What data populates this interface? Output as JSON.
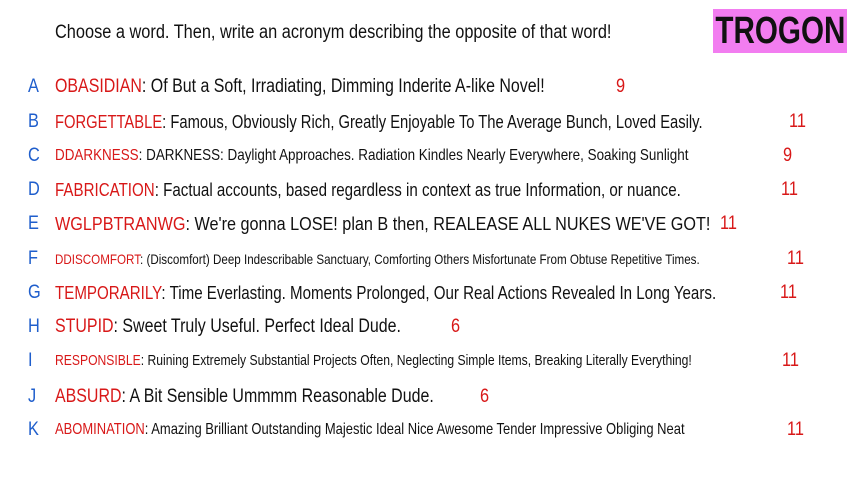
{
  "prompt": "Choose a word. Then, write an acronym describing the opposite of that word!",
  "logo_text": "TROGON",
  "colors": {
    "letter": "#1f5ecc",
    "word": "#d81818",
    "number": "#d81818",
    "logo_bg": "#f27df0"
  },
  "rows": [
    {
      "letter": "A",
      "word": "OBASIDIAN",
      "sep": ":  ",
      "definition": "Of But a Soft, Irradiating, Dimming Inderite A-like Novel!",
      "number": "9"
    },
    {
      "letter": "B",
      "word": "FORGETTABLE",
      "sep": ":  ",
      "definition": "Famous, Obviously Rich, Greatly Enjoyable To The Average Bunch, Loved Easily.",
      "number": "11"
    },
    {
      "letter": "C",
      "word": "DDARKNESS",
      "sep": ":  ",
      "definition": "DARKNESS: Daylight Approaches. Radiation Kindles Nearly Everywhere, Soaking Sunlight",
      "number": "9"
    },
    {
      "letter": "D",
      "word": "FABRICATION",
      "sep": ":  ",
      "definition": "Factual accounts, based regardless in context as true Information, or nuance.",
      "number": "11"
    },
    {
      "letter": "E",
      "word": "WGLPBTRANWG",
      "sep": ":  ",
      "definition": "We're gonna LOSE! plan B then, REALEASE ALL NUKES WE'VE GOT!",
      "number": "11"
    },
    {
      "letter": "F",
      "word": "DDISCOMFORT",
      "sep": ":  ",
      "definition": "(Discomfort) Deep Indescribable Sanctuary, Comforting Others Misfortunate From Obtuse Repetitive Times.",
      "number": "11"
    },
    {
      "letter": "G",
      "word": "TEMPORARILY",
      "sep": ":  ",
      "definition": "Time Everlasting. Moments Prolonged, Our Real Actions Revealed In Long Years.",
      "number": "11"
    },
    {
      "letter": "H",
      "word": "STUPID",
      "sep": ":  ",
      "definition": "Sweet Truly Useful. Perfect Ideal Dude.",
      "number": "6"
    },
    {
      "letter": "I",
      "word": "RESPONSIBLE",
      "sep": ":  ",
      "definition": "Ruining Extremely Substantial Projects Often, Neglecting Simple Items, Breaking Literally Everything!",
      "number": "11"
    },
    {
      "letter": "J",
      "word": "ABSURD",
      "sep": ":   ",
      "definition": "A Bit Sensible Ummmm Reasonable Dude.",
      "number": "6"
    },
    {
      "letter": "K",
      "word": "ABOMINATION",
      "sep": ":  ",
      "definition": "Amazing Brilliant Outstanding Majestic Ideal Nice Awesome Tender Impressive Obliging Neat",
      "number": "11"
    }
  ]
}
